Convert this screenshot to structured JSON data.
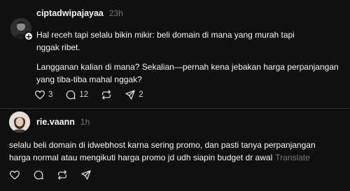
{
  "posts": [
    {
      "username": "ciptadwipajayaa",
      "time": "23h",
      "follow_symbol": "+",
      "paragraphs": [
        "Hal receh tapi selalu bikin mikir: beli domain di mana yang murah tapi",
        "nggak ribet.",
        "Langganan kalian di mana? Sekalian—pernah kena jebakan harga perpanjangan",
        "yang tiba-tiba mahal nggak?"
      ],
      "actions": {
        "like_count": "3",
        "reply_count": "12",
        "share_count": "2"
      },
      "avatar_color": "#3a3a3a"
    },
    {
      "username": "rie.vaann",
      "time": "1h",
      "lines": [
        "selalu beli domain di idwebhost karna sering promo, dan pasti tanya perpanjangan",
        "harga normal atau mengikuti harga promo jd udh siapin budget dr awal"
      ],
      "translate_label": "Translate",
      "avatar_color": "#d9d3cc"
    }
  ],
  "icons": [
    "heart-icon",
    "comment-icon",
    "repost-icon",
    "share-icon"
  ],
  "colors": {
    "background": "#101010",
    "text": "#f3f5f7",
    "muted": "#777777"
  }
}
